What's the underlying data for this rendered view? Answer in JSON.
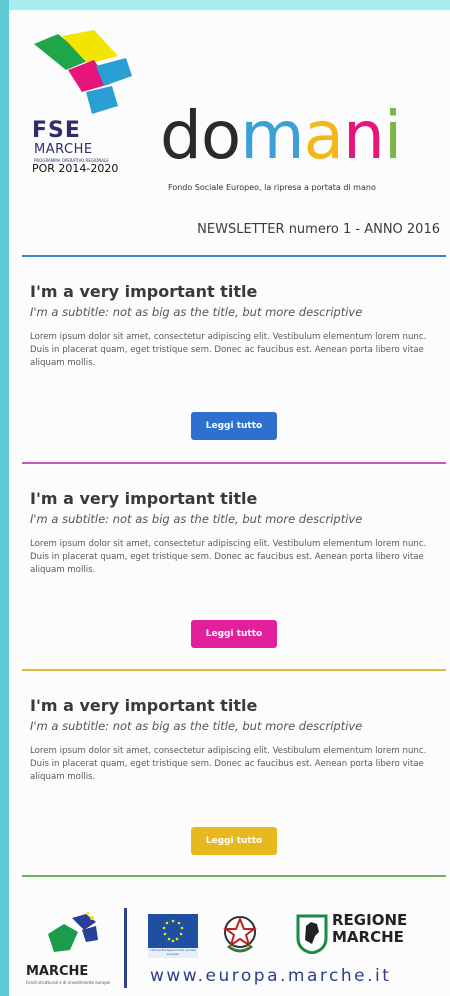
{
  "header": {
    "fse_logo": {
      "big": "FSE",
      "region": "MARCHE",
      "small": "PROGRAMMA OPERATIVO REGIONALE",
      "por": "POR 2014-2020",
      "colors": [
        "#f2e600",
        "#1fa64a",
        "#e6157a",
        "#2a9fd6"
      ]
    },
    "brand": {
      "letters": [
        "d",
        "o",
        "m",
        "a",
        "n",
        "i"
      ],
      "colors": [
        "#2a2a2a",
        "#2a2a2a",
        "#3aa0d8",
        "#f0b81a",
        "#e6157a",
        "#7ab648"
      ]
    },
    "tagline": "Fondo Sociale Europeo, la ripresa a portata di mano",
    "newsletter": "NEWSLETTER numero 1 - ANNO 2016"
  },
  "articles": [
    {
      "title": "I'm a very important title",
      "subtitle": "I'm a subtitle: not as big as the title, but more descriptive",
      "body": "Lorem ipsum dolor sit amet, consectetur adipiscing elit. Vestibulum elementum lorem nunc. Duis in placerat quam, eget tristique sem. Donec ac faucibus est. Aenean porta libero vitae aliquam mollis.",
      "button": "Leggi tutto",
      "color": "#2f6fce"
    },
    {
      "title": "I'm a very important title",
      "subtitle": "I'm a subtitle: not as big as the title, but more descriptive",
      "body": "Lorem ipsum dolor sit amet, consectetur adipiscing elit. Vestibulum elementum lorem nunc. Duis in placerat quam, eget tristique sem. Donec ac faucibus est. Aenean porta libero vitae aliquam mollis.",
      "button": "Leggi tutto",
      "color": "#e3209b"
    },
    {
      "title": "I'm a very important title",
      "subtitle": "I'm a subtitle: not as big as the title, but more descriptive",
      "body": "Lorem ipsum dolor sit amet, consectetur adipiscing elit. Vestibulum elementum lorem nunc. Duis in placerat quam, eget tristique sem. Donec ac faucibus est. Aenean porta libero vitae aliquam mollis.",
      "button": "Leggi tutto",
      "color": "#e8b91e"
    }
  ],
  "dividers": {
    "colors": [
      "#3a7fd0",
      "#c25ab8",
      "#d9bf3a",
      "#6cb25a"
    ]
  },
  "footer": {
    "marche_logo": {
      "name": "MARCHE",
      "small": "Fondi strutturali e di investimento europei"
    },
    "eu_caption": "Unione Europea Fondo sociale europeo",
    "regione": [
      "REGIONE",
      "MARCHE"
    ],
    "url": "www.europa.marche.it"
  }
}
